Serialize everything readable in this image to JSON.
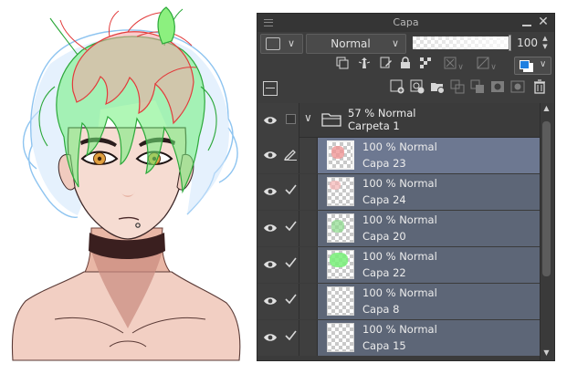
{
  "panel": {
    "title": "Capa",
    "blend_mode": "Normal",
    "opacity_value": "100",
    "opacity_fraction": 1.0,
    "accent_color": "#1e7fe0",
    "selected_bg": "#6d7891",
    "row_bg": "#5d6677"
  },
  "folder": {
    "line1": "57 % Normal",
    "line2": "Carpeta 1"
  },
  "layers": [
    {
      "line1": "100 % Normal",
      "line2": "Capa 23",
      "mark": "pen-icon",
      "selected": true,
      "thumb": "pink"
    },
    {
      "line1": "100 % Normal",
      "line2": "Capa 24",
      "mark": "check-icon",
      "selected": false,
      "thumb": "pink-light"
    },
    {
      "line1": "100 % Normal",
      "line2": "Capa 20",
      "mark": "check-icon",
      "selected": false,
      "thumb": "green-light"
    },
    {
      "line1": "100 % Normal",
      "line2": "Capa 22",
      "mark": "check-icon",
      "selected": false,
      "thumb": "green"
    },
    {
      "line1": "100 % Normal",
      "line2": "Capa 8",
      "mark": "check-icon",
      "selected": false,
      "thumb": "empty"
    },
    {
      "line1": "100 % Normal",
      "line2": "Capa 15",
      "mark": "check-icon",
      "selected": false,
      "thumb": "empty"
    }
  ]
}
